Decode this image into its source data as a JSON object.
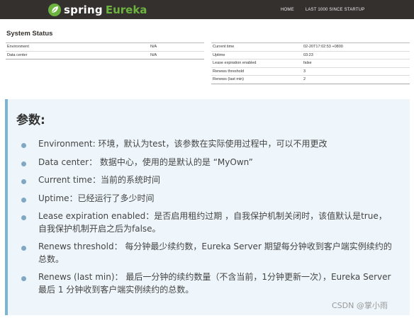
{
  "navbar": {
    "brand_spring": "spring",
    "brand_eureka": "Eureka",
    "links": [
      "HOME",
      "LAST 1000 SINCE STARTUP"
    ],
    "colors": {
      "background": "#34302d",
      "accent": "#6db33f"
    }
  },
  "system_status": {
    "title": "System Status",
    "left_table": [
      {
        "key": "Environment",
        "value": "N/A"
      },
      {
        "key": "Data center",
        "value": "N/A"
      }
    ],
    "right_table": [
      {
        "key": "Current time",
        "value": "02-20T17:02:53 +0800"
      },
      {
        "key": "Uptime",
        "value": "03:23"
      },
      {
        "key": "Lease expiration enabled",
        "value": "false"
      },
      {
        "key": "Renews threshold",
        "value": "3"
      },
      {
        "key": "Renews (last min)",
        "value": "2"
      }
    ]
  },
  "notes": {
    "title": "参数:",
    "items": [
      [
        "Environment: 环境，默认为test，该参数在实际使用过程中，可以不用更改"
      ],
      [
        "Data center： 数据中心，使用的是默认的是 “MyOwn”"
      ],
      [
        "Current time：当前的系统时间"
      ],
      [
        "Uptime：已经运行了多少时间"
      ],
      [
        "Lease expiration enabled：是否启用租约过期 ，自我保护机制关闭时，该值默认是true，",
        "自我保护机制开启之后为false。"
      ],
      [
        "Renews threshold： 每分钟最少续约数，Eureka Server 期望每分钟收到客户端实例续约的",
        "总数。"
      ],
      [
        "Renews (last min)： 最后一分钟的续约数量（不含当前，1分钟更新一次），Eureka Server",
        "最后 1 分钟收到客户端实例续约的总数。"
      ]
    ]
  },
  "watermark": "CSDN @掌小雨"
}
